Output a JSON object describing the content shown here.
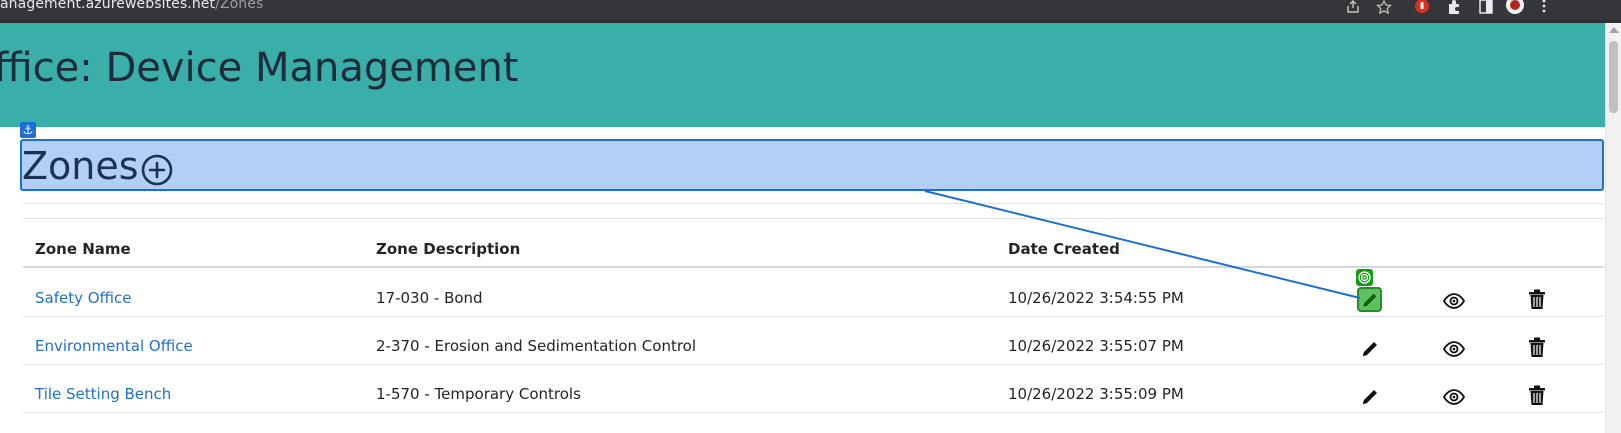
{
  "browser": {
    "url_host": "anagement.azurewebsites.net",
    "url_path": "/Zones"
  },
  "header": {
    "title": "ffice: Device Management"
  },
  "page": {
    "heading": "Zones"
  },
  "table": {
    "columns": [
      "Zone Name",
      "Zone Description",
      "Date Created"
    ],
    "rows": [
      {
        "name": "Safety Office",
        "description": "17-030 - Bond",
        "date": "10/26/2022 3:54:55 PM"
      },
      {
        "name": "Environmental Office",
        "description": "2-370 - Erosion and Sedimentation Control",
        "date": "10/26/2022 3:55:07 PM"
      },
      {
        "name": "Tile Setting Bench",
        "description": "1-570 - Temporary Controls",
        "date": "10/26/2022 3:55:09 PM"
      }
    ]
  },
  "icons": {
    "add": "add-circle-icon",
    "edit": "pencil-icon",
    "view": "eye-icon",
    "delete": "trash-icon",
    "anchor": "anchor-icon",
    "target": "target-icon"
  },
  "colors": {
    "header_bg": "#3aafa9",
    "link": "#2470c8",
    "highlight_bg": "#b4cff6",
    "highlight_border": "#1b6fd6",
    "target_green": "#5bc35b"
  }
}
